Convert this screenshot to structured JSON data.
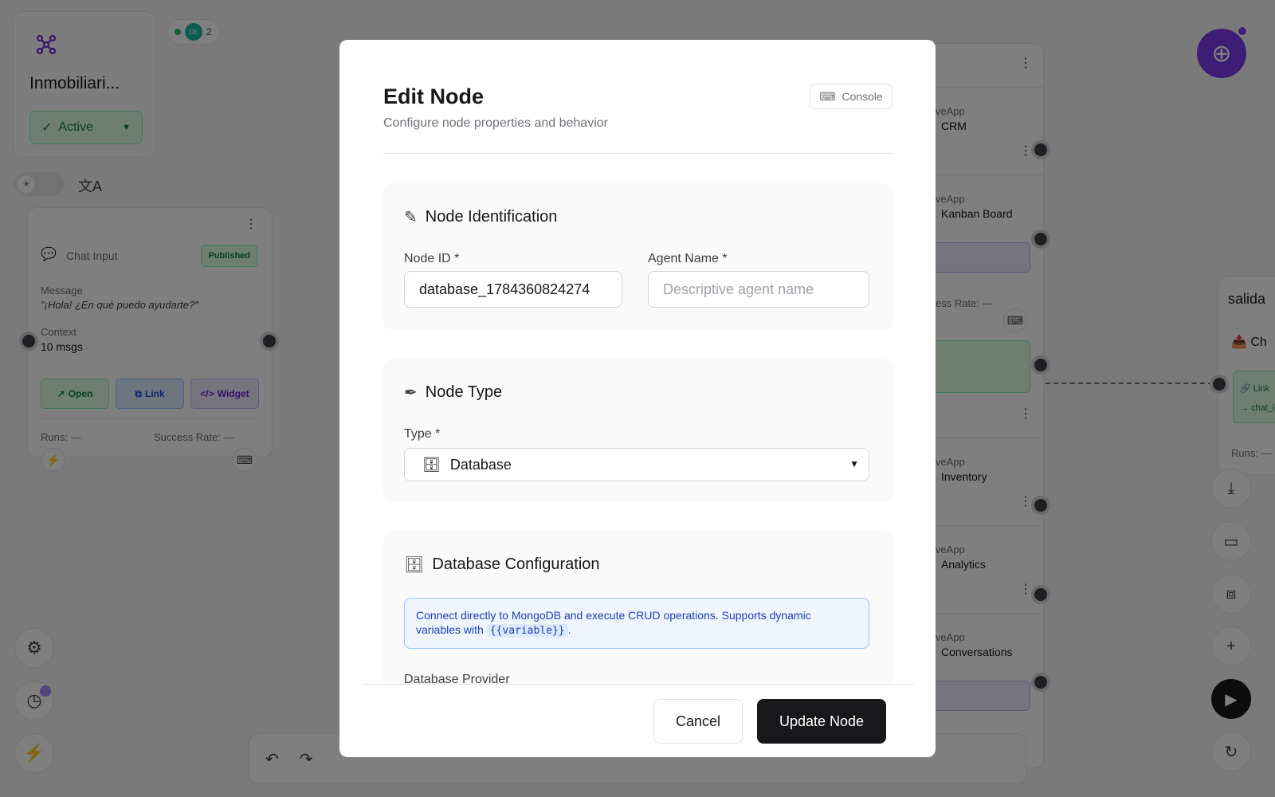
{
  "project": {
    "name": "Inmobiliari...",
    "status": "Active",
    "users_avatar": "DE",
    "users_count": "2"
  },
  "chat_node": {
    "title": "Chat Input",
    "badge": "Published",
    "message_label": "Message",
    "message_value": "\"¡Hola! ¿En qué puedo ayudarte?\"",
    "context_label": "Context",
    "context_value": "10 msgs",
    "actions": {
      "open": "Open",
      "link": "Link",
      "widget": "Widget"
    },
    "runs": "Runs: —",
    "success_rate": "Success Rate: —"
  },
  "right_column": {
    "items": [
      {
        "sub": "iveApp",
        "name": "CRM"
      },
      {
        "sub": "iveApp",
        "name": "Kanban Board"
      },
      {
        "sub": "iveApp",
        "name": "Inventory"
      },
      {
        "sub": "iveApp",
        "name": "Analytics"
      },
      {
        "sub": "iveApp",
        "name": "Conversations"
      }
    ],
    "success_rate": "ccess Rate: —"
  },
  "salida": {
    "title": "salida",
    "ch": "Ch",
    "link": "Link",
    "chat": "→ chat_i",
    "runs": "Runs: —"
  },
  "modal": {
    "title": "Edit Node",
    "subtitle": "Configure node properties and behavior",
    "console_label": "Console",
    "identification": {
      "title": "Node Identification",
      "node_id_label": "Node ID *",
      "node_id_value": "database_1784360824274",
      "agent_name_label": "Agent Name *",
      "agent_name_placeholder": "Descriptive agent name"
    },
    "node_type": {
      "title": "Node Type",
      "type_label": "Type *",
      "type_icon": "🗄",
      "type_value": "Database"
    },
    "db_config": {
      "title": "Database Configuration",
      "info_text": "Connect directly to MongoDB and execute CRUD operations. Supports dynamic variables with",
      "info_code": "{{variable}}",
      "info_end": ".",
      "provider_label": "Database Provider"
    },
    "footer": {
      "cancel": "Cancel",
      "update": "Update Node"
    }
  }
}
